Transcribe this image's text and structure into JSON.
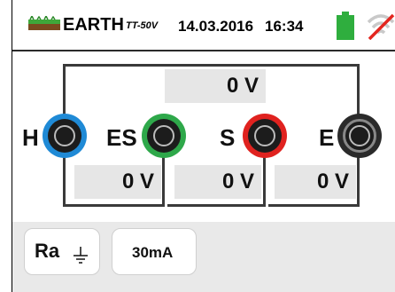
{
  "header": {
    "mode": "EARTH",
    "submode": "TT-50V",
    "date": "14.03.2016",
    "time": "16:34",
    "battery_icon": "battery-icon",
    "wifi_icon": "wifi-off-icon",
    "earth_icon": "earth-ground-icon"
  },
  "measurements": {
    "top_voltage": "0 V",
    "es_voltage": "0 V",
    "s_voltage": "0 V",
    "e_voltage": "0 V"
  },
  "terminals": [
    {
      "label": "H",
      "color": "#1f8ad6"
    },
    {
      "label": "ES",
      "color": "#2ea84a"
    },
    {
      "label": "S",
      "color": "#e0221f"
    },
    {
      "label": "E",
      "color": "#2a2a2a"
    }
  ],
  "buttons": {
    "function_label": "Ra",
    "current_label": "30mA"
  },
  "colors": {
    "battery": "#2fae3e",
    "wifi_slash": "#e3261f"
  }
}
